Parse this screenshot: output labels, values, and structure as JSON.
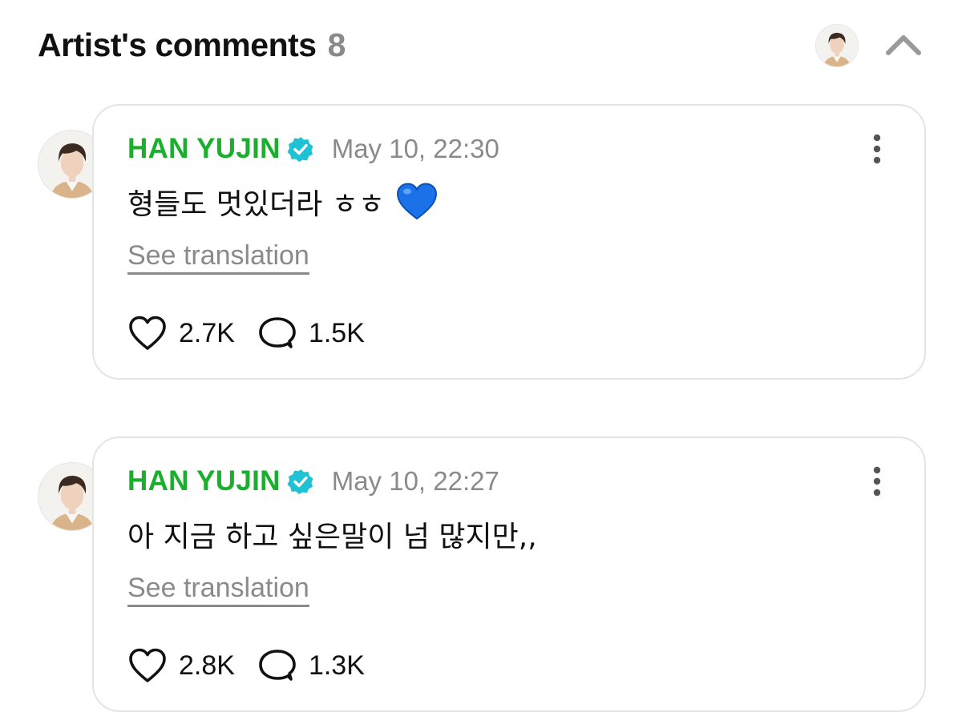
{
  "header": {
    "title": "Artist's comments",
    "count": "8"
  },
  "comments": [
    {
      "author": "HAN YUJIN",
      "time": "May 10, 22:30",
      "text": "형들도 멋있더라 ㅎㅎ",
      "emoji": "blue-heart",
      "translate_label": "See translation",
      "likes": "2.7K",
      "replies": "1.5K"
    },
    {
      "author": "HAN YUJIN",
      "time": "May 10, 22:27",
      "text": "아 지금 하고 싶은말이 넘 많지만,,",
      "emoji": "",
      "translate_label": "See translation",
      "likes": "2.8K",
      "replies": "1.3K"
    }
  ],
  "colors": {
    "author": "#1aaf2d",
    "verified": "#1fc1d4",
    "muted": "#8a8a8a",
    "heart_emoji": "#1b72e8"
  }
}
